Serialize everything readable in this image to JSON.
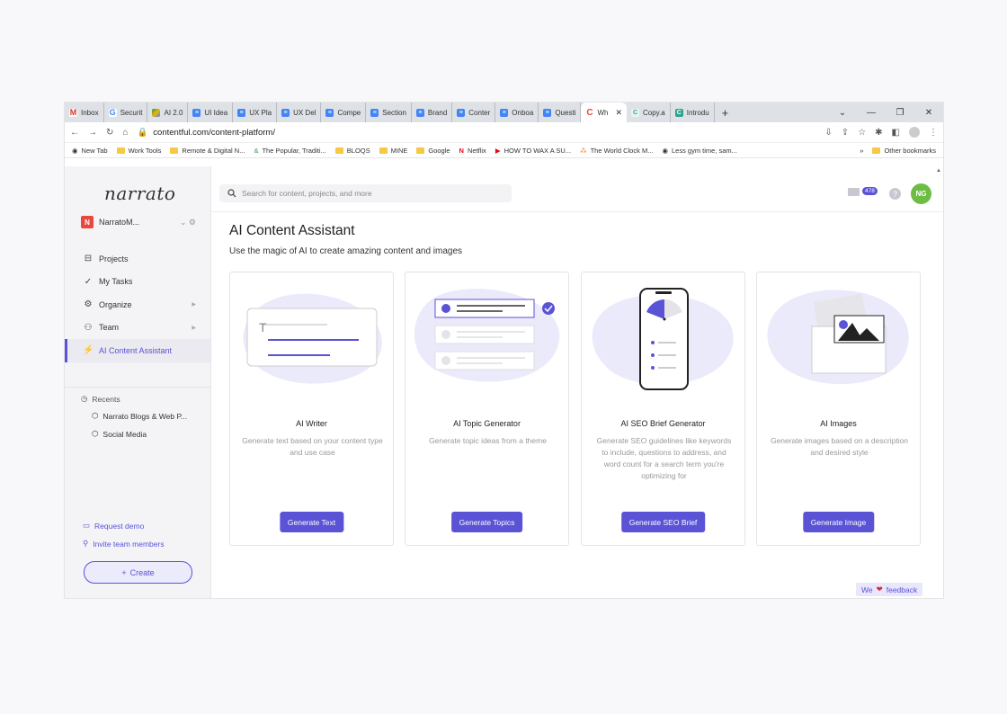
{
  "browser": {
    "tabs": [
      {
        "label": "Inbox",
        "icon": "gmail-icon"
      },
      {
        "label": "Securit",
        "icon": "google-icon"
      },
      {
        "label": "AI 2.0",
        "icon": "drive-icon"
      },
      {
        "label": "UI Idea",
        "icon": "docs-icon"
      },
      {
        "label": "UX Pla",
        "icon": "docs-icon"
      },
      {
        "label": "UX Del",
        "icon": "docs-icon"
      },
      {
        "label": "Compe",
        "icon": "docs-icon"
      },
      {
        "label": "Section",
        "icon": "docs-icon"
      },
      {
        "label": "Brand",
        "icon": "docs-icon"
      },
      {
        "label": "Conter",
        "icon": "docs-icon"
      },
      {
        "label": "Onboa",
        "icon": "docs-icon"
      },
      {
        "label": "Questi",
        "icon": "docs-icon"
      },
      {
        "label": "Wh",
        "icon": "contentful-icon",
        "active": true
      },
      {
        "label": "Copy.a",
        "icon": "copyai-icon"
      },
      {
        "label": "Introdu",
        "icon": "intro-icon"
      }
    ],
    "url": "contentful.com/content-platform/",
    "bookmarks": [
      "New Tab",
      "Work Tools",
      "Remote & Digital N...",
      "The Popular, Traditi...",
      "BLOQS",
      "MINE",
      "Google",
      "Netflix",
      "HOW TO WAX A SU...",
      "The World Clock M...",
      "Less gym time, sam..."
    ],
    "other_bookmarks": "Other bookmarks",
    "overflow": "»"
  },
  "sidebar": {
    "logo": "narrato",
    "workspace": {
      "badge": "N",
      "name": "NarratoM..."
    },
    "nav": [
      {
        "label": "Projects",
        "icon": "briefcase-icon"
      },
      {
        "label": "My Tasks",
        "icon": "checklist-icon"
      },
      {
        "label": "Organize",
        "icon": "gears-icon"
      },
      {
        "label": "Team",
        "icon": "team-icon"
      },
      {
        "label": "AI Content Assistant",
        "icon": "lightning-icon",
        "active": true
      }
    ],
    "recents_label": "Recents",
    "recents": [
      "Narrato Blogs & Web P...",
      "Social Media"
    ],
    "request_demo": "Request demo",
    "invite": "Invite team members",
    "create": "Create"
  },
  "topbar": {
    "search_placeholder": "Search for content, projects, and more",
    "mail_count": "478",
    "help": "?",
    "avatar": "NG"
  },
  "main": {
    "title": "AI Content Assistant",
    "subtitle": "Use the magic of AI to create amazing content and images",
    "cards": [
      {
        "title": "AI Writer",
        "desc": "Generate text based on your content type and use case",
        "button": "Generate Text"
      },
      {
        "title": "AI Topic Generator",
        "desc": "Generate topic ideas from a theme",
        "button": "Generate Topics"
      },
      {
        "title": "AI SEO Brief Generator",
        "desc": "Generate SEO guidelines like keywords to include, questions to address, and word count for a search term you're optimizing for",
        "button": "Generate SEO Brief"
      },
      {
        "title": "AI Images",
        "desc": "Generate images based on a description and desired style",
        "button": "Generate Image"
      }
    ]
  },
  "feedback": {
    "prefix": "We",
    "suffix": "feedback"
  },
  "colors": {
    "accent": "#5a53d6",
    "blob": "#ebeafb",
    "avatar": "#6dbd45",
    "workspace_badge": "#e8483e"
  }
}
